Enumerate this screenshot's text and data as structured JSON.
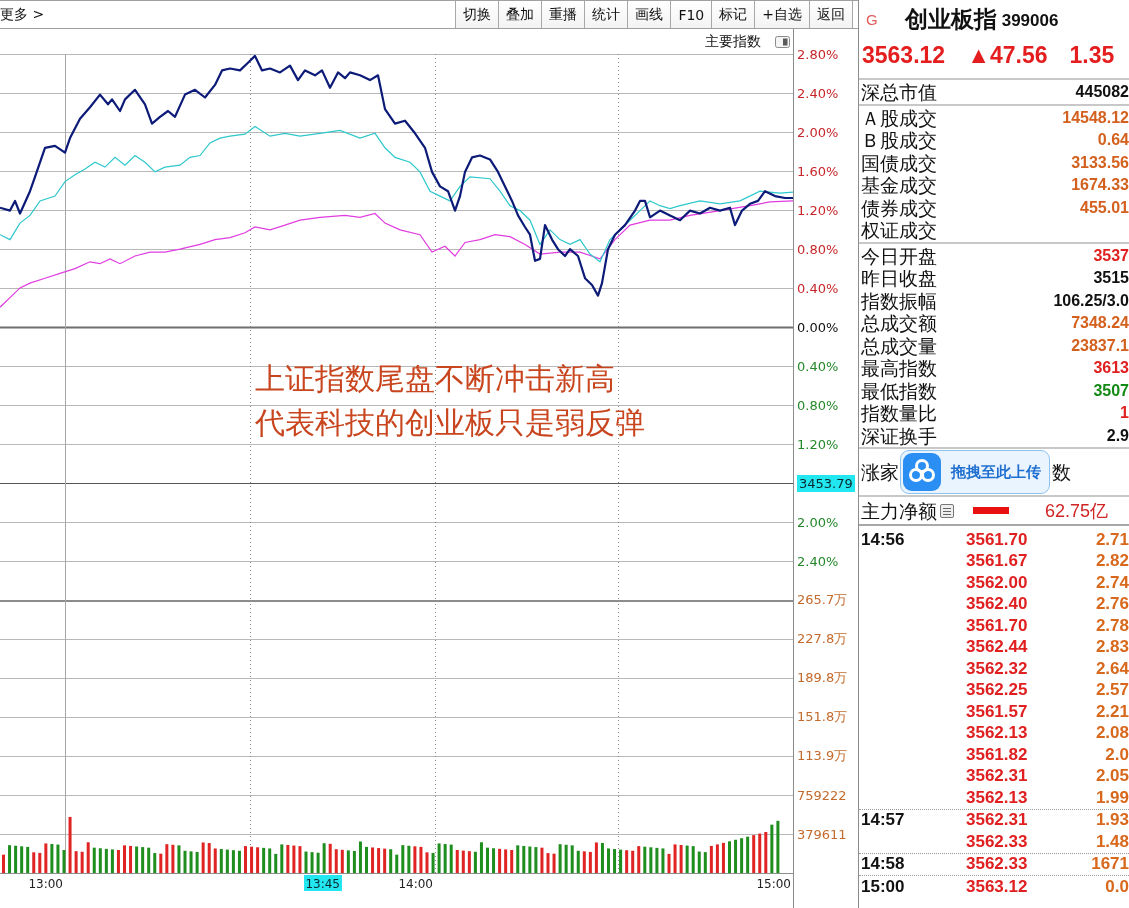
{
  "toolbar": {
    "more": "更多 >",
    "buttons": [
      "切换",
      "叠加",
      "重播",
      "统计",
      "画线",
      "F10",
      "标记",
      "+自选",
      "返回"
    ]
  },
  "chart": {
    "title": "主要指数",
    "price_axis": [
      {
        "label": "2.80%",
        "kind": "up"
      },
      {
        "label": "2.40%",
        "kind": "up"
      },
      {
        "label": "2.00%",
        "kind": "up"
      },
      {
        "label": "1.60%",
        "kind": "up"
      },
      {
        "label": "1.20%",
        "kind": "up"
      },
      {
        "label": "0.80%",
        "kind": "up"
      },
      {
        "label": "0.40%",
        "kind": "up"
      },
      {
        "label": "0.00%",
        "kind": "zero"
      },
      {
        "label": "0.40%",
        "kind": "down"
      },
      {
        "label": "0.80%",
        "kind": "down"
      },
      {
        "label": "1.20%",
        "kind": "down"
      },
      {
        "label": "3453.79",
        "kind": "cursor"
      },
      {
        "label": "2.00%",
        "kind": "down"
      },
      {
        "label": "2.40%",
        "kind": "down"
      }
    ],
    "volume_axis": [
      "265.7万",
      "227.8万",
      "189.8万",
      "151.8万",
      "113.9万",
      "759222",
      "379611"
    ],
    "time_axis": [
      {
        "label": "13:00",
        "kind": "plain"
      },
      {
        "label": "13:45",
        "kind": "cursor"
      },
      {
        "label": "14:00",
        "kind": "plain"
      },
      {
        "label": "15:00",
        "kind": "plain"
      }
    ],
    "annotation": [
      "上证指数尾盘不断冲击新高",
      "代表科技的创业板只是弱反弹"
    ]
  },
  "quote": {
    "marker": "G",
    "name": "创业板指",
    "code": "399006",
    "price": "3563.12",
    "change": "▲47.56",
    "change_pct": "1.35"
  },
  "stat_groups": [
    [
      {
        "label": "深总市值",
        "value": "445082",
        "color": "#111111"
      }
    ],
    [
      {
        "label": "Ａ股成交",
        "value": "14548.12",
        "color": "#d4601e"
      },
      {
        "label": "Ｂ股成交",
        "value": "0.64",
        "color": "#d4601e"
      },
      {
        "label": "国债成交",
        "value": "3133.56",
        "color": "#d4601e"
      },
      {
        "label": "基金成交",
        "value": "1674.33",
        "color": "#d4601e"
      },
      {
        "label": "债券成交",
        "value": "455.01",
        "color": "#d4601e"
      },
      {
        "label": "权证成交"
      }
    ],
    [
      {
        "label": "今日开盘",
        "value": "3537",
        "color": "#e02020"
      },
      {
        "label": "昨日收盘",
        "value": "3515",
        "color": "#111111"
      },
      {
        "label": "指数振幅",
        "value": "106.25/3.0",
        "color": "#111111"
      },
      {
        "label": "总成交额",
        "value": "7348.24",
        "color": "#d4601e"
      },
      {
        "label": "总成交量",
        "value": "23837.1",
        "color": "#d4601e"
      },
      {
        "label": "最高指数",
        "value": "3613",
        "color": "#e02020"
      },
      {
        "label": "最低指数",
        "value": "3507",
        "color": "#138a13"
      },
      {
        "label": "指数量比",
        "value": "1",
        "color": "#e02020"
      },
      {
        "label": "深证换手",
        "value": "2.9",
        "color": "#111111"
      }
    ]
  ],
  "breadth": {
    "label": "涨家",
    "label_tail": "数"
  },
  "upload_hint": {
    "label": "拖拽至此上传"
  },
  "main_flow": {
    "label": "主力净额",
    "value": "62.75亿"
  },
  "ticks": [
    {
      "time": "14:56",
      "rows": [
        {
          "price": "3561.70",
          "volume": "2.71"
        },
        {
          "price": "3561.67",
          "volume": "2.82"
        },
        {
          "price": "3562.00",
          "volume": "2.74"
        },
        {
          "price": "3562.40",
          "volume": "2.76"
        },
        {
          "price": "3561.70",
          "volume": "2.78"
        },
        {
          "price": "3562.44",
          "volume": "2.83"
        },
        {
          "price": "3562.32",
          "volume": "2.64"
        },
        {
          "price": "3562.25",
          "volume": "2.57"
        },
        {
          "price": "3561.57",
          "volume": "2.21"
        },
        {
          "price": "3562.13",
          "volume": "2.08"
        },
        {
          "price": "3561.82",
          "volume": "2.0"
        },
        {
          "price": "3562.31",
          "volume": "2.05"
        },
        {
          "price": "3562.13",
          "volume": "1.99"
        }
      ]
    },
    {
      "time": "14:57",
      "rows": [
        {
          "price": "3562.31",
          "volume": "1.93"
        },
        {
          "price": "3562.33",
          "volume": "1.48"
        }
      ]
    },
    {
      "time": "14:58",
      "rows": [
        {
          "price": "3562.33",
          "volume": "1671"
        }
      ]
    },
    {
      "time": "15:00",
      "rows": [
        {
          "price": "3563.12",
          "volume": "0.0"
        }
      ]
    }
  ]
}
